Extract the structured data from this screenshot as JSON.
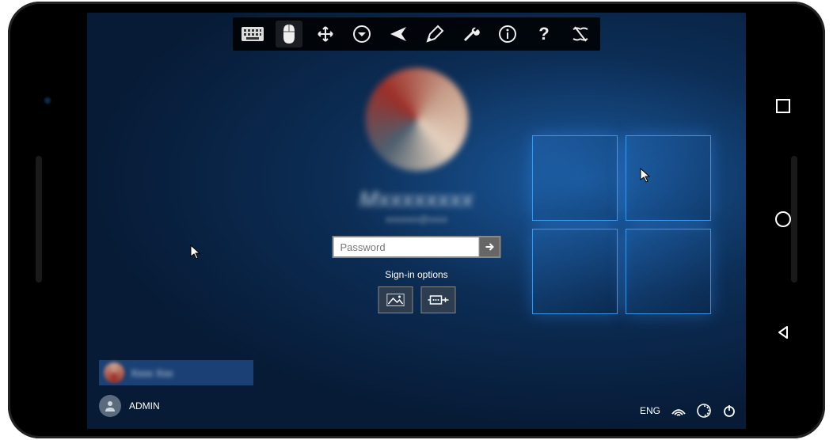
{
  "toolbar": {
    "icons": [
      "keyboard",
      "mouse",
      "move",
      "menu-down",
      "send",
      "pen",
      "wrench",
      "info",
      "help",
      "erase"
    ]
  },
  "login": {
    "password_placeholder": "Password",
    "signin_options_label": "Sign-in options"
  },
  "bottom_left": {
    "admin_label": "ADMIN"
  },
  "tray": {
    "lang": "ENG"
  }
}
